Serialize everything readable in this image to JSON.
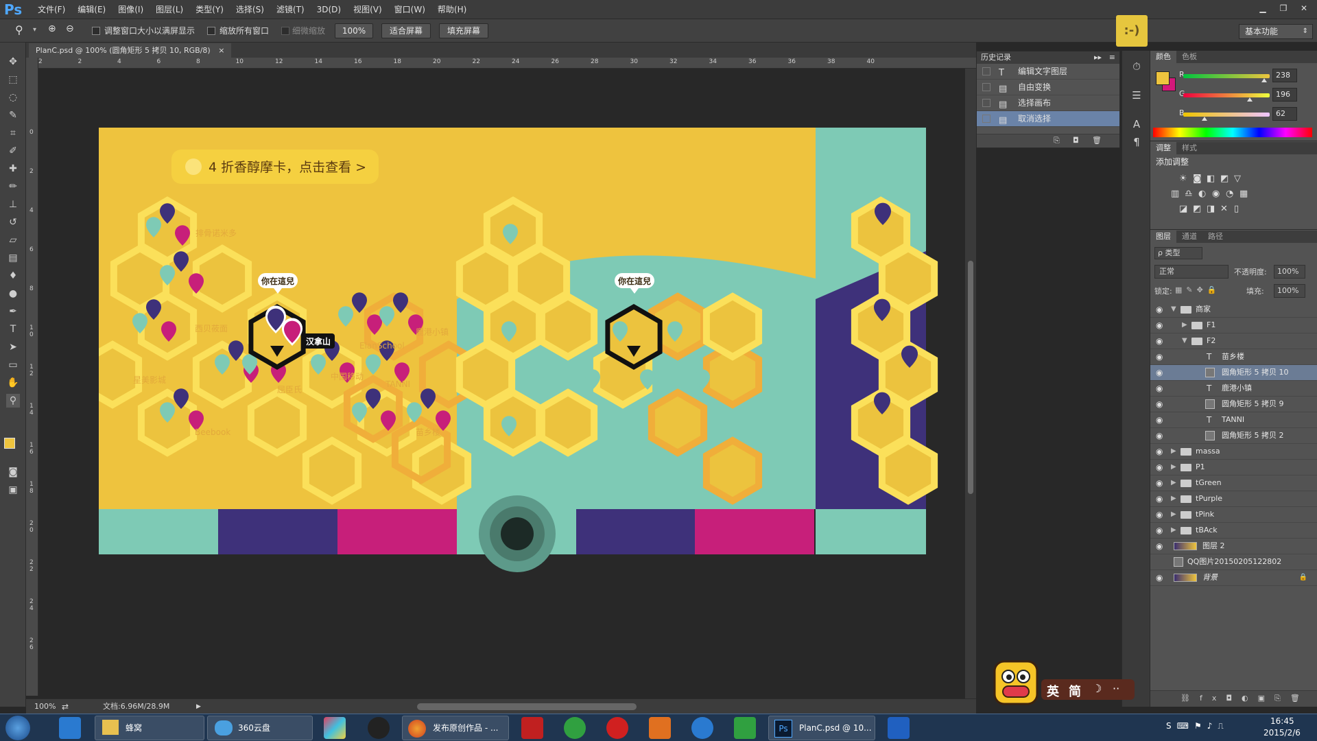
{
  "app": {
    "logo": "Ps"
  },
  "menu": [
    "文件(F)",
    "编辑(E)",
    "图像(I)",
    "图层(L)",
    "类型(Y)",
    "选择(S)",
    "滤镜(T)",
    "3D(D)",
    "视图(V)",
    "窗口(W)",
    "帮助(H)"
  ],
  "window_controls": {
    "min": "▁",
    "max": "❐",
    "close": "✕"
  },
  "options": {
    "resize_windows": "调整窗口大小以满屏显示",
    "zoom_all": "缩放所有窗口",
    "scrubby_zoom": "细微缩放",
    "zoom_value": "100%",
    "fit_screen": "适合屏幕",
    "fill_screen": "填充屏幕",
    "workspace": "基本功能"
  },
  "smiley_text": ":-)",
  "doc_tab": {
    "title": "PlanC.psd @ 100% (圆角矩形 5 拷贝 10, RGB/8)",
    "close": "×"
  },
  "ruler_h": [
    "2",
    "2",
    "4",
    "6",
    "8",
    "10",
    "12",
    "14",
    "16",
    "18",
    "20",
    "22",
    "24",
    "26",
    "28",
    "30",
    "32",
    "34",
    "36",
    "36",
    "38",
    "40"
  ],
  "ruler_v": [
    "0",
    "2",
    "4",
    "6",
    "8",
    "1 0",
    "1 2",
    "1 4",
    "1 6",
    "1 8",
    "2 0",
    "2 2",
    "2 4",
    "2 6"
  ],
  "artboard": {
    "banner": "4 折香醇摩卡，点击查看 >",
    "you_are_here": "你在這兒",
    "selected_store": "汉拿山",
    "stores": [
      "排骨诺米多",
      "西贝莜面",
      "星美影城",
      "Beebook",
      "ElanSchool",
      "鹿港小镇",
      "屈臣氏",
      "中国移动",
      "TANNI",
      "苗乡楼"
    ]
  },
  "status": {
    "zoom": "100%",
    "doc": "文档:6.96M/28.9M"
  },
  "history": {
    "title": "历史记录",
    "items": [
      {
        "icon": "T",
        "label": "编辑文字图层"
      },
      {
        "icon": "▤",
        "label": "自由变换"
      },
      {
        "icon": "▤",
        "label": "选择画布"
      },
      {
        "icon": "▤",
        "label": "取消选择"
      }
    ]
  },
  "color_panel": {
    "tabs": [
      "颜色",
      "色板"
    ],
    "r_label": "R",
    "g_label": "G",
    "b_label": "B",
    "r": "238",
    "g": "196",
    "b": "62",
    "fg": "#eec43e",
    "bg": "#d4187a"
  },
  "adjust_panel": {
    "tabs": [
      "调整",
      "样式"
    ],
    "title": "添加调整"
  },
  "layers_panel": {
    "tabs": [
      "图层",
      "通道",
      "路径"
    ],
    "filter": "ρ 类型",
    "blend": "正常",
    "opacity_label": "不透明度:",
    "opacity": "100%",
    "lock_label": "锁定:",
    "fill_label": "填充:",
    "fill": "100%",
    "layers": [
      {
        "name": "商家",
        "kind": "group",
        "depth": 0,
        "open": true
      },
      {
        "name": "F1",
        "kind": "group",
        "depth": 1,
        "open": false
      },
      {
        "name": "F2",
        "kind": "group",
        "depth": 1,
        "open": true
      },
      {
        "name": "苗乡楼",
        "kind": "text",
        "depth": 2
      },
      {
        "name": "圆角矩形 5 拷贝 10",
        "kind": "shape",
        "depth": 2,
        "selected": true
      },
      {
        "name": "鹿港小镇",
        "kind": "text",
        "depth": 2
      },
      {
        "name": "圆角矩形 5 拷贝 9",
        "kind": "shape",
        "depth": 2
      },
      {
        "name": "TANNI",
        "kind": "text",
        "depth": 2
      },
      {
        "name": "圆角矩形 5 拷贝 2",
        "kind": "shape",
        "depth": 2
      },
      {
        "name": "massa",
        "kind": "group",
        "depth": 0,
        "open": false
      },
      {
        "name": "P1",
        "kind": "group",
        "depth": 0,
        "open": false
      },
      {
        "name": "tGreen",
        "kind": "group",
        "depth": 0,
        "open": false
      },
      {
        "name": "tPurple",
        "kind": "group",
        "depth": 0,
        "open": false
      },
      {
        "name": "tPink",
        "kind": "group",
        "depth": 0,
        "open": false
      },
      {
        "name": "tBAck",
        "kind": "group",
        "depth": 0,
        "open": false
      },
      {
        "name": "图层 2",
        "kind": "pixel",
        "depth": 0
      },
      {
        "name": "QQ图片20150205122802",
        "kind": "smart",
        "depth": 0,
        "hidden": true
      },
      {
        "name": "背景",
        "kind": "pixel",
        "depth": 0,
        "locked": true
      }
    ]
  },
  "ime": {
    "lang": "英",
    "mode": "简",
    "moon": "☽",
    "dots": "··"
  },
  "taskbar": {
    "items": [
      {
        "label": "蜂窝"
      },
      {
        "label": "360云盘"
      },
      {
        "label": "发布原创作品 - ..."
      },
      {
        "label": "PlanC.psd @ 10..."
      }
    ],
    "time": "16:45",
    "date": "2015/2/6"
  }
}
